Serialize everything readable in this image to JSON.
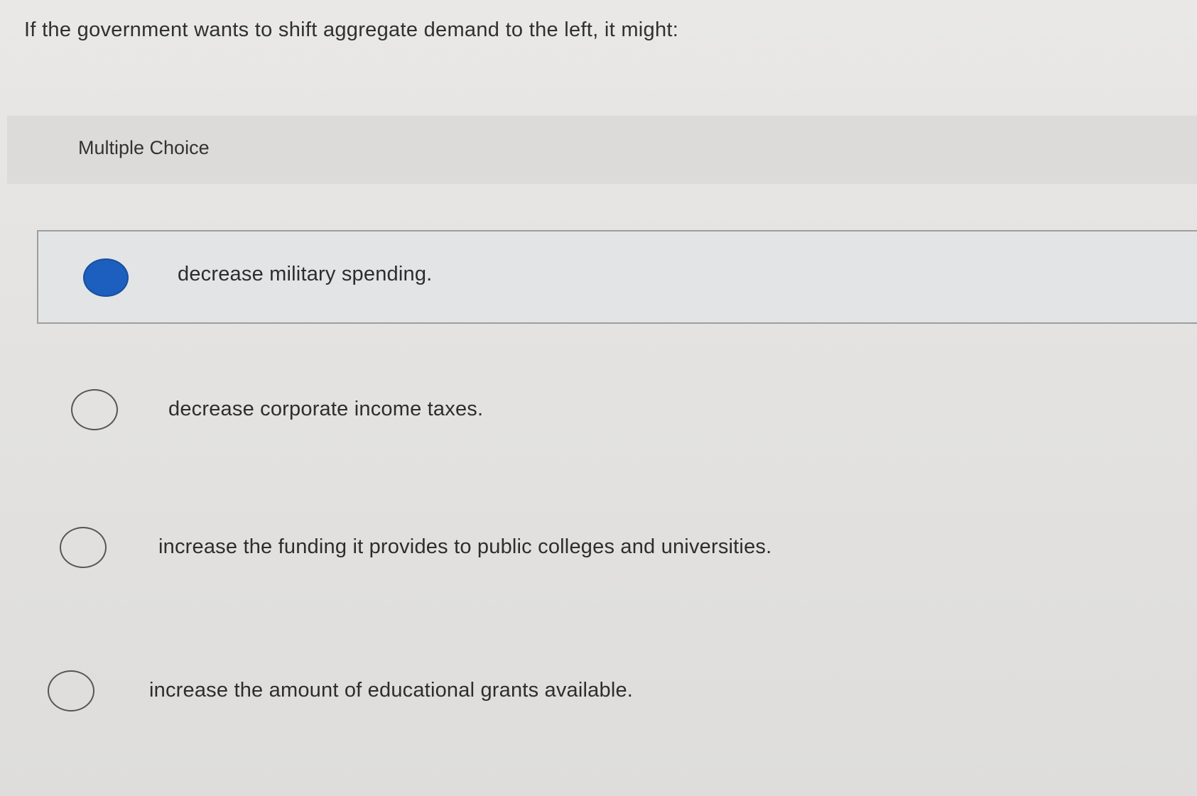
{
  "question": "If the government wants to shift aggregate demand to the left, it might:",
  "section_label": "Multiple Choice",
  "options": [
    {
      "label": "decrease military spending.",
      "selected": true
    },
    {
      "label": "decrease corporate income taxes.",
      "selected": false
    },
    {
      "label": "increase the funding it provides to public colleges and universities.",
      "selected": false
    },
    {
      "label": "increase the amount of educational grants available.",
      "selected": false
    }
  ],
  "colors": {
    "selected_radio": "#1c5fbf",
    "background": "#e6e5e3"
  }
}
